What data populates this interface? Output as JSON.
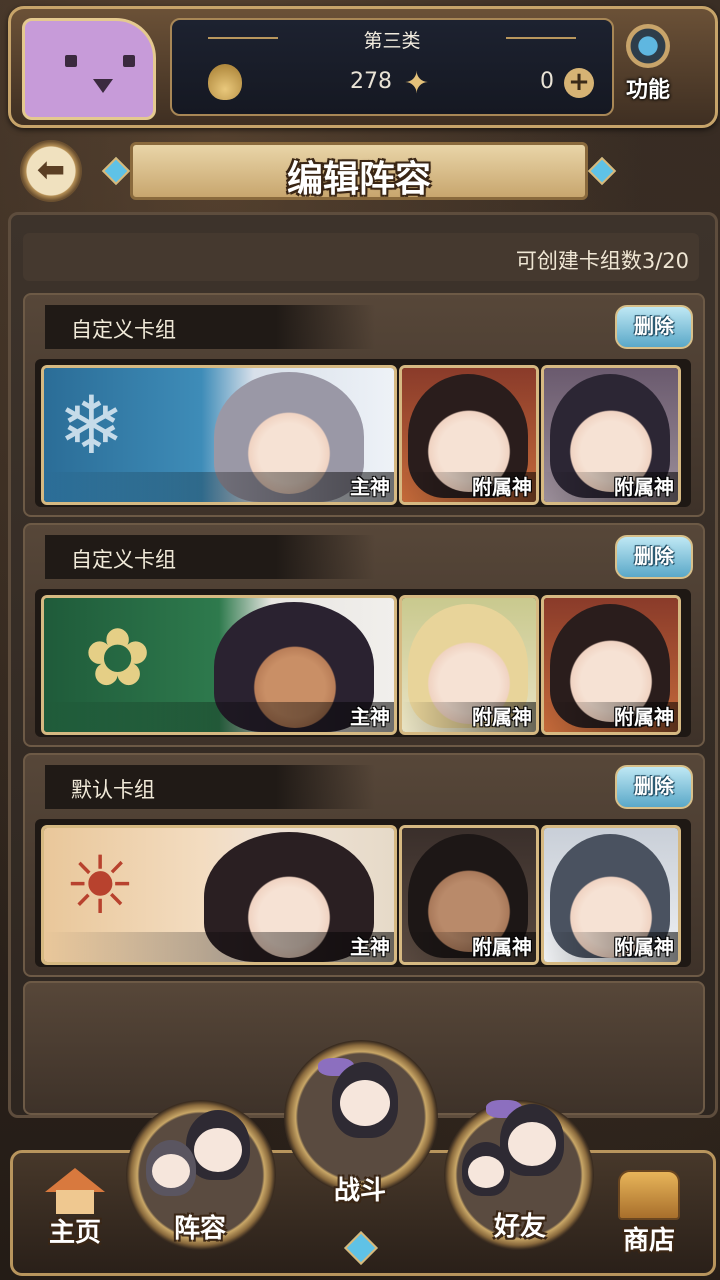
{
  "hud": {
    "chapter": "第三类",
    "currency1_icon": "flame-spirit-icon",
    "currency1_value": "278",
    "currency2_icon": "butterfly-icon",
    "currency2_value": "0",
    "function_label": "功能"
  },
  "title": "编辑阵容",
  "deck_count_text": "可创建卡组数3/20",
  "decks": [
    {
      "name": "自定义卡组",
      "delete_label": "删除",
      "main_label": "主神",
      "sub1_label": "附属神",
      "sub2_label": "附属神"
    },
    {
      "name": "自定义卡组",
      "delete_label": "删除",
      "main_label": "主神",
      "sub1_label": "附属神",
      "sub2_label": "附属神"
    },
    {
      "name": "默认卡组",
      "delete_label": "删除",
      "main_label": "主神",
      "sub1_label": "附属神",
      "sub2_label": "附属神"
    }
  ],
  "nav": {
    "home": "主页",
    "lineup": "阵容",
    "battle": "战斗",
    "friends": "好友",
    "shop": "商店"
  },
  "colors": {
    "accent_gold": "#c7a46a",
    "delete_blue": "#5aa8c8",
    "panel_brown": "#3d332b"
  }
}
